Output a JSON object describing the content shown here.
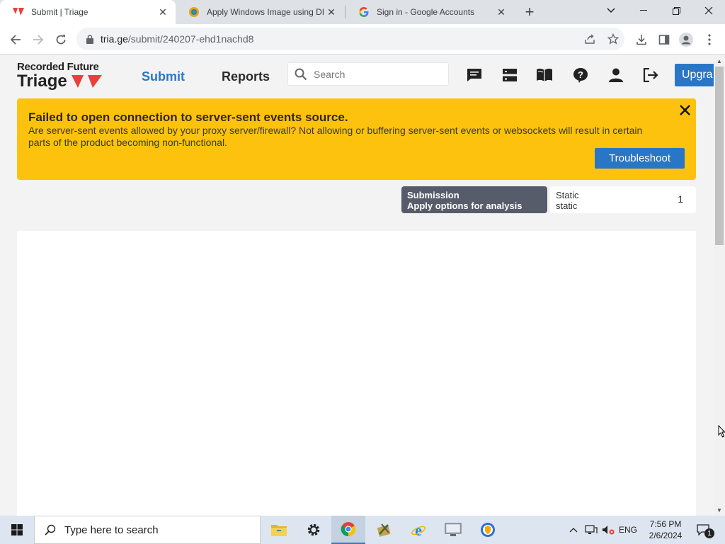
{
  "browser": {
    "tabs": [
      {
        "title": "Submit | Triage",
        "active": true,
        "favicon": "triage-icon"
      },
      {
        "title": "Apply Windows Image using DIS",
        "active": false,
        "favicon": "ms-icon"
      },
      {
        "title": "Sign in - Google Accounts",
        "active": false,
        "favicon": "google-icon"
      }
    ],
    "url_host": "tria.ge",
    "url_path": "/submit/240207-ehd1nachd8"
  },
  "header": {
    "brand_top": "Recorded Future",
    "brand_main": "Triage",
    "nav": [
      {
        "label": "Submit",
        "color": "#2a76c6"
      },
      {
        "label": "Reports",
        "color": "#2b2b2b"
      }
    ],
    "search_placeholder": "Search",
    "upgrade_label": "Upgra"
  },
  "banner": {
    "title": "Failed to open connection to server-sent events source.",
    "message": "Are server-sent events allowed by your proxy server/firewall? Not allowing or buffering server-sent events or websockets will result in certain parts of the product becoming non-functional.",
    "button": "Troubleshoot",
    "color": "#fcc20d"
  },
  "steps": {
    "current_title": "Submission",
    "current_subtitle": "Apply options for analysis",
    "next_title": "Static",
    "next_subtitle": "static",
    "next_count": "1"
  },
  "taskbar": {
    "search_placeholder": "Type here to search",
    "language": "ENG",
    "time": "7:56 PM",
    "date": "2/6/2024",
    "notification_count": "1"
  }
}
